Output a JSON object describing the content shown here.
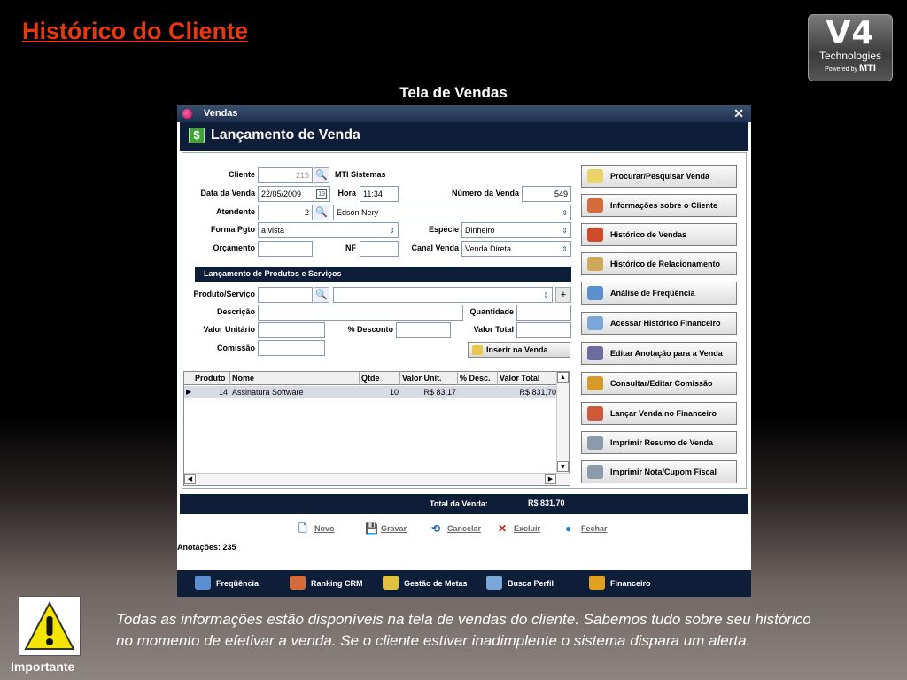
{
  "slide": {
    "title": "Histórico do Cliente",
    "subtitle": "Tela de Vendas",
    "logo": {
      "main": "V4",
      "line2": "Technologies",
      "powered": "Powered by",
      "brand": "MTI"
    },
    "warning_label": "Importante",
    "note": "Todas as informações estão disponíveis na tela de vendas do cliente. Sabemos tudo sobre seu histórico no momento de efetivar a venda. Se o cliente estiver inadimplente o sistema dispara um alerta."
  },
  "window": {
    "title": "Vendas",
    "close_glyph": "✕",
    "header": "Lançamento de Venda",
    "header_icon": "$"
  },
  "form": {
    "cliente": {
      "label": "Cliente",
      "code": "215",
      "name": "MTI Sistemas"
    },
    "data_venda": {
      "label": "Data da Venda",
      "value": "22/05/2009"
    },
    "hora": {
      "label": "Hora",
      "value": "11:34"
    },
    "numero_venda": {
      "label": "Número da Venda",
      "value": "549"
    },
    "atendente": {
      "label": "Atendente",
      "code": "2",
      "name": "Edson Nery"
    },
    "forma_pgto": {
      "label": "Forma Pgto",
      "value": "a vista"
    },
    "especie": {
      "label": "Espécie",
      "value": "Dinheiro"
    },
    "orcamento": {
      "label": "Orçamento",
      "value": ""
    },
    "nf": {
      "label": "NF",
      "value": ""
    },
    "canal_venda": {
      "label": "Canal Venda",
      "value": "Venda Direta"
    }
  },
  "products": {
    "section_title": "Lançamento de Produtos e Serviços",
    "produto_label": "Produto/Serviço",
    "descricao_label": "Descrição",
    "quantidade_label": "Quantidade",
    "valor_unitario_label": "Valor Unitário",
    "desconto_label": "% Desconto",
    "valor_total_label": "Valor Total",
    "comissao_label": "Comissão",
    "insert_button": "Inserir na Venda"
  },
  "grid": {
    "columns": [
      "Produto",
      "Nome",
      "Qtde",
      "Valor Unit.",
      "% Desc.",
      "Valor Total"
    ],
    "rows": [
      {
        "produto": "14",
        "nome": "Assinatura Software",
        "qtde": "10",
        "valor_unit": "R$ 83,17",
        "desc": "",
        "valor_total": "R$ 831,70"
      }
    ]
  },
  "side_buttons": [
    {
      "label": "Procurar/Pesquisar Venda",
      "icon": "magnifier-icon",
      "color": "#e9d36a"
    },
    {
      "label": "Informações sobre o Cliente",
      "icon": "users-icon",
      "color": "#d46b3d"
    },
    {
      "label": "Histórico de Vendas",
      "icon": "book-icon",
      "color": "#d04a2a"
    },
    {
      "label": "Histórico de Relacionamento",
      "icon": "clipboard-icon",
      "color": "#cfa85a"
    },
    {
      "label": "Análise de Freqüência",
      "icon": "chart-icon",
      "color": "#5b8fcf"
    },
    {
      "label": "Acessar  Histórico Financeiro",
      "icon": "document-icon",
      "color": "#7aa6d8"
    },
    {
      "label": "Editar Anotação para a Venda",
      "icon": "pencil-icon",
      "color": "#6d6d9d"
    },
    {
      "label": "Consultar/Editar Comissão",
      "icon": "money-icon",
      "color": "#d49a2a"
    },
    {
      "label": "Lançar Venda no Financeiro",
      "icon": "finance-icon",
      "color": "#d0583a"
    },
    {
      "label": "Imprimir Resumo de Venda",
      "icon": "printer-icon",
      "color": "#8c9aac"
    },
    {
      "label": "Imprimir Nota/Cupom Fiscal",
      "icon": "printer-icon",
      "color": "#8c9aac"
    }
  ],
  "total": {
    "label": "Total da Venda:",
    "value": "R$ 831,70"
  },
  "toolbar": [
    {
      "label": "Novo",
      "icon": "new-icon",
      "glyph": "🗋",
      "color": "#4a7ab8"
    },
    {
      "label": "Gravar",
      "icon": "save-icon",
      "glyph": "💾",
      "color": "#3a5fa0"
    },
    {
      "label": "Cancelar",
      "icon": "cancel-icon",
      "glyph": "⟲",
      "color": "#2a62c0"
    },
    {
      "label": "Excluir",
      "icon": "delete-icon",
      "glyph": "✕",
      "color": "#d01818"
    },
    {
      "label": "Fechar",
      "icon": "close-icon",
      "glyph": "●",
      "color": "#2a7ad0"
    }
  ],
  "annotations": {
    "label": "Anotações:",
    "count": "235"
  },
  "bottom_nav": [
    {
      "label": "Freqüência",
      "icon": "chart-icon",
      "color": "#5b8fcf"
    },
    {
      "label": "Ranking CRM",
      "icon": "ranking-icon",
      "color": "#d46b3d"
    },
    {
      "label": "Gestão de Metas",
      "icon": "goals-icon",
      "color": "#e0c040"
    },
    {
      "label": "Busca Perfil",
      "icon": "profile-icon",
      "color": "#7aa6d8"
    },
    {
      "label": "Financeiro",
      "icon": "finance-icon",
      "color": "#e0a020"
    }
  ]
}
